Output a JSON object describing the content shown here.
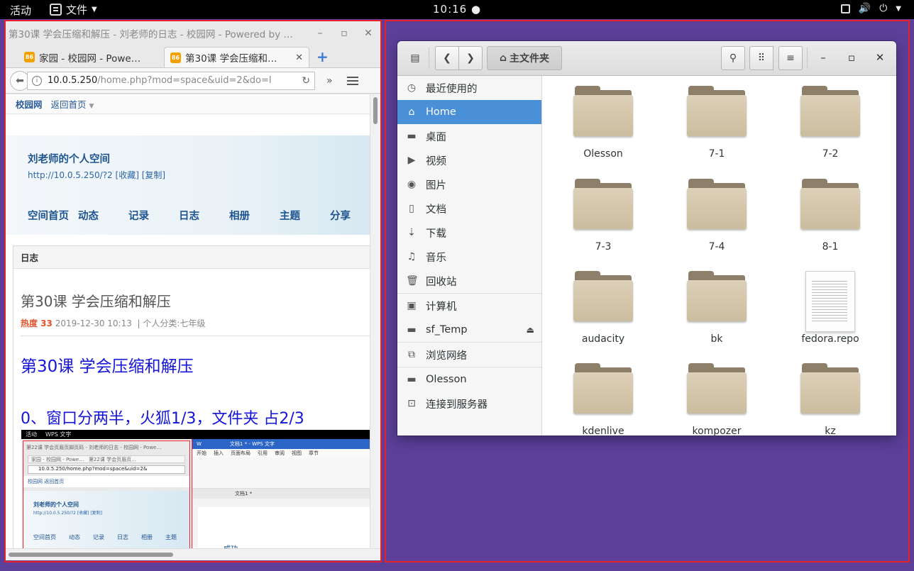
{
  "topbar": {
    "activities": "活动",
    "app_menu": "文件",
    "clock": "10:16"
  },
  "firefox": {
    "window_title": "第30课 学会压缩和解压 - 刘老师的日志 - 校园网 - Powered by …",
    "tabs": [
      {
        "label": "家园 - 校园网 - Powe…",
        "favicon": "86"
      },
      {
        "label": "第30课 学会压缩和…",
        "favicon": "86"
      }
    ],
    "url_host": "10.0.5.250",
    "url_path": "/home.php?mod=space&uid=2&do=l",
    "page": {
      "site_name": "校园网",
      "back_home": "返回首页",
      "owner_title": "刘老师的个人空间",
      "owner_link": "http://10.0.5.250/?2 [收藏] [复制]",
      "nav": [
        "空间首页",
        "动态",
        "记录",
        "日志",
        "相册",
        "主题",
        "分享"
      ],
      "section": "日志",
      "post_title": "第30课 学会压缩和解压",
      "hot_label": "热度 33",
      "post_date": "2019-12-30 10:13",
      "post_category": "个人分类:七年级",
      "heading1": "第30课 学会压缩和解压",
      "heading2": "0、窗口分两半，火狐1/3，文件夹 占2/3"
    },
    "thumbnail": {
      "top_activities": "活动",
      "top_app": "WPS 文字",
      "ff_title": "第22课 学会页眉页脚页码 - 刘老师的日志 - 校园网 - Powe…",
      "ff_tab1": "家园 - 校园网 - Powe…",
      "ff_tab2": "第22课 学会页眉页…",
      "ff_url": "10.0.5.250/home.php?mod=space&uid=2&",
      "ff_site": "校园网  返回首页",
      "ff_owner": "刘老师的个人空间",
      "ff_link": "http://10.0.5.250/?2 [收藏] [复制]",
      "ff_nav": [
        "空间首页",
        "动态",
        "记录",
        "日志",
        "相册",
        "主题"
      ],
      "wps_title": "文档1 * - WPS 文字",
      "wps_ribbon": [
        "开始",
        "插入",
        "页面布局",
        "引用",
        "审阅",
        "视图",
        "章节"
      ],
      "wps_doc_tab": "文档1 *",
      "wps_doc_word": "成功"
    }
  },
  "nautilus": {
    "location": "主文件夹",
    "sidebar": [
      {
        "label": "最近使用的",
        "icon": "clock-icon"
      },
      {
        "label": "Home",
        "icon": "home-icon",
        "selected": true
      },
      {
        "label": "桌面",
        "icon": "folder-icon"
      },
      {
        "label": "视频",
        "icon": "video-icon"
      },
      {
        "label": "图片",
        "icon": "camera-icon"
      },
      {
        "label": "文档",
        "icon": "document-icon"
      },
      {
        "label": "下载",
        "icon": "download-icon"
      },
      {
        "label": "音乐",
        "icon": "music-icon"
      },
      {
        "label": "回收站",
        "icon": "trash-icon"
      },
      {
        "label": "计算机",
        "icon": "computer-icon"
      },
      {
        "label": "sf_Temp",
        "icon": "drive-icon"
      },
      {
        "label": "浏览网络",
        "icon": "network-icon"
      },
      {
        "label": "Olesson",
        "icon": "folder-icon"
      },
      {
        "label": "连接到服务器",
        "icon": "server-icon"
      }
    ],
    "files": [
      {
        "name": "Olesson",
        "type": "folder"
      },
      {
        "name": "7-1",
        "type": "folder"
      },
      {
        "name": "7-2",
        "type": "folder"
      },
      {
        "name": "7-3",
        "type": "folder"
      },
      {
        "name": "7-4",
        "type": "folder"
      },
      {
        "name": "8-1",
        "type": "folder"
      },
      {
        "name": "audacity",
        "type": "folder"
      },
      {
        "name": "bk",
        "type": "folder"
      },
      {
        "name": "fedora.repo",
        "type": "file"
      },
      {
        "name": "kdenlive",
        "type": "folder"
      },
      {
        "name": "kompozer",
        "type": "folder"
      },
      {
        "name": "kz",
        "type": "folder"
      }
    ]
  },
  "colors": {
    "desktop": "#5b3f99",
    "highlight_outline": "#e8202a",
    "selection": "#4a90d9",
    "post_heading": "#1515d8"
  }
}
